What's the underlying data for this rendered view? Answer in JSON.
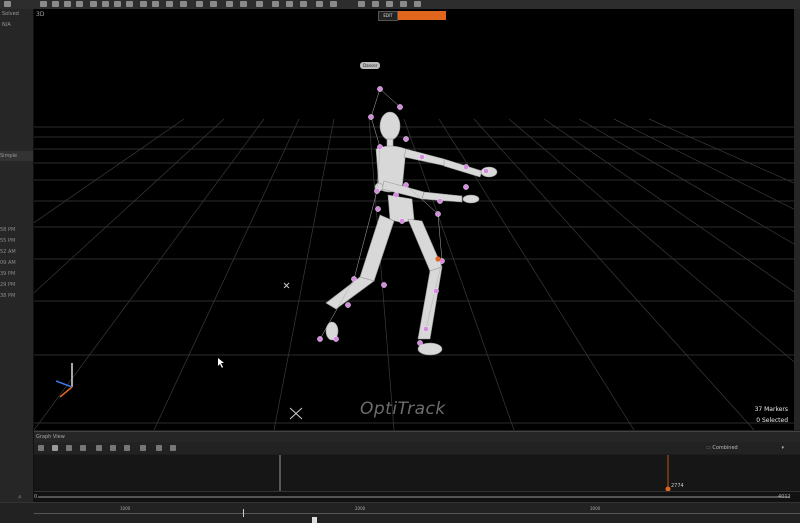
{
  "left_panel": {
    "row1": "Solved",
    "row2": "N/A",
    "section_label": "Simple",
    "times": [
      "58 PM",
      "55 PM",
      "52 AM",
      "09 AM",
      "39 PM",
      "29 PM",
      "38 PM"
    ]
  },
  "viewport": {
    "view_label": "3D",
    "edit_button": "EDIT",
    "record_button": "",
    "asset_label": "Dancer",
    "markers_count": "37 Markers",
    "selected_count": "0 Selected",
    "logo": "OptiTrack"
  },
  "graph": {
    "header": "Graph View",
    "combined_label": "Combined",
    "marker_frame": "2774"
  },
  "timeline": {
    "start_frame": "0",
    "end_frame": "4012",
    "ruler_labels": [
      "1000",
      "2000",
      "3000"
    ]
  },
  "colors": {
    "accent": "#e0661e",
    "marker": "#d48be0",
    "grid": "#3a3a3a"
  }
}
